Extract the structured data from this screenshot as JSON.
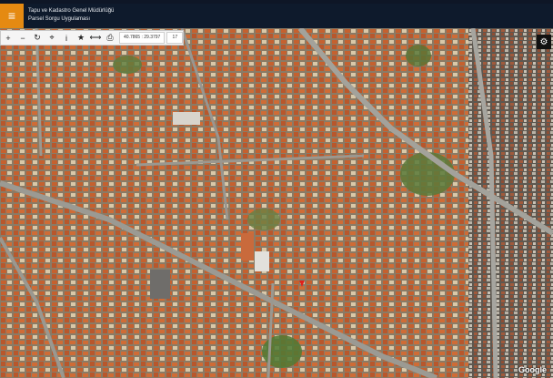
{
  "header": {
    "title_line1": "Tapu ve Kadastro Genel Müdürlüğü",
    "title_line2": "Parsel Sorgu Uygulaması",
    "menu_icon": "≡"
  },
  "toolbar": {
    "zoom_in_icon": "+",
    "zoom_out_icon": "−",
    "refresh_icon": "↻",
    "locate_icon": "⌖",
    "info_icon": "i",
    "favorite_icon": "★",
    "measure_icon": "⟷",
    "print_icon": "⎙",
    "coordinates": "40.7865 : 29.3797",
    "zoom_level": "17"
  },
  "settings_icon": "⚙",
  "attribution": "Google",
  "colors": {
    "header_bg": "#0e1a2c",
    "menu_accent": "#e58a12",
    "marker": "#e0201a"
  }
}
